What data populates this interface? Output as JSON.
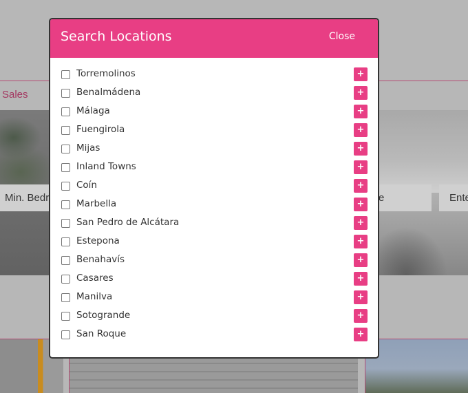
{
  "background": {
    "nav_link": "Sales",
    "search_fields": [
      {
        "text": "Min. Bedr"
      },
      {
        "text": "e"
      },
      {
        "text": "Ente"
      }
    ]
  },
  "modal": {
    "title": "Search Locations",
    "close_label": "Close",
    "add_icon": "+",
    "accent_color": "#e83e84",
    "locations": [
      {
        "label": "Torremolinos",
        "checked": false
      },
      {
        "label": "Benalmádena",
        "checked": false
      },
      {
        "label": "Málaga",
        "checked": false
      },
      {
        "label": "Fuengirola",
        "checked": false
      },
      {
        "label": "Mijas",
        "checked": false
      },
      {
        "label": "Inland Towns",
        "checked": false
      },
      {
        "label": "Coín",
        "checked": false
      },
      {
        "label": "Marbella",
        "checked": false
      },
      {
        "label": "San Pedro de Alcátara",
        "checked": false
      },
      {
        "label": "Estepona",
        "checked": false
      },
      {
        "label": "Benahavís",
        "checked": false
      },
      {
        "label": "Casares",
        "checked": false
      },
      {
        "label": "Manilva",
        "checked": false
      },
      {
        "label": "Sotogrande",
        "checked": false
      },
      {
        "label": "San Roque",
        "checked": false
      }
    ]
  }
}
